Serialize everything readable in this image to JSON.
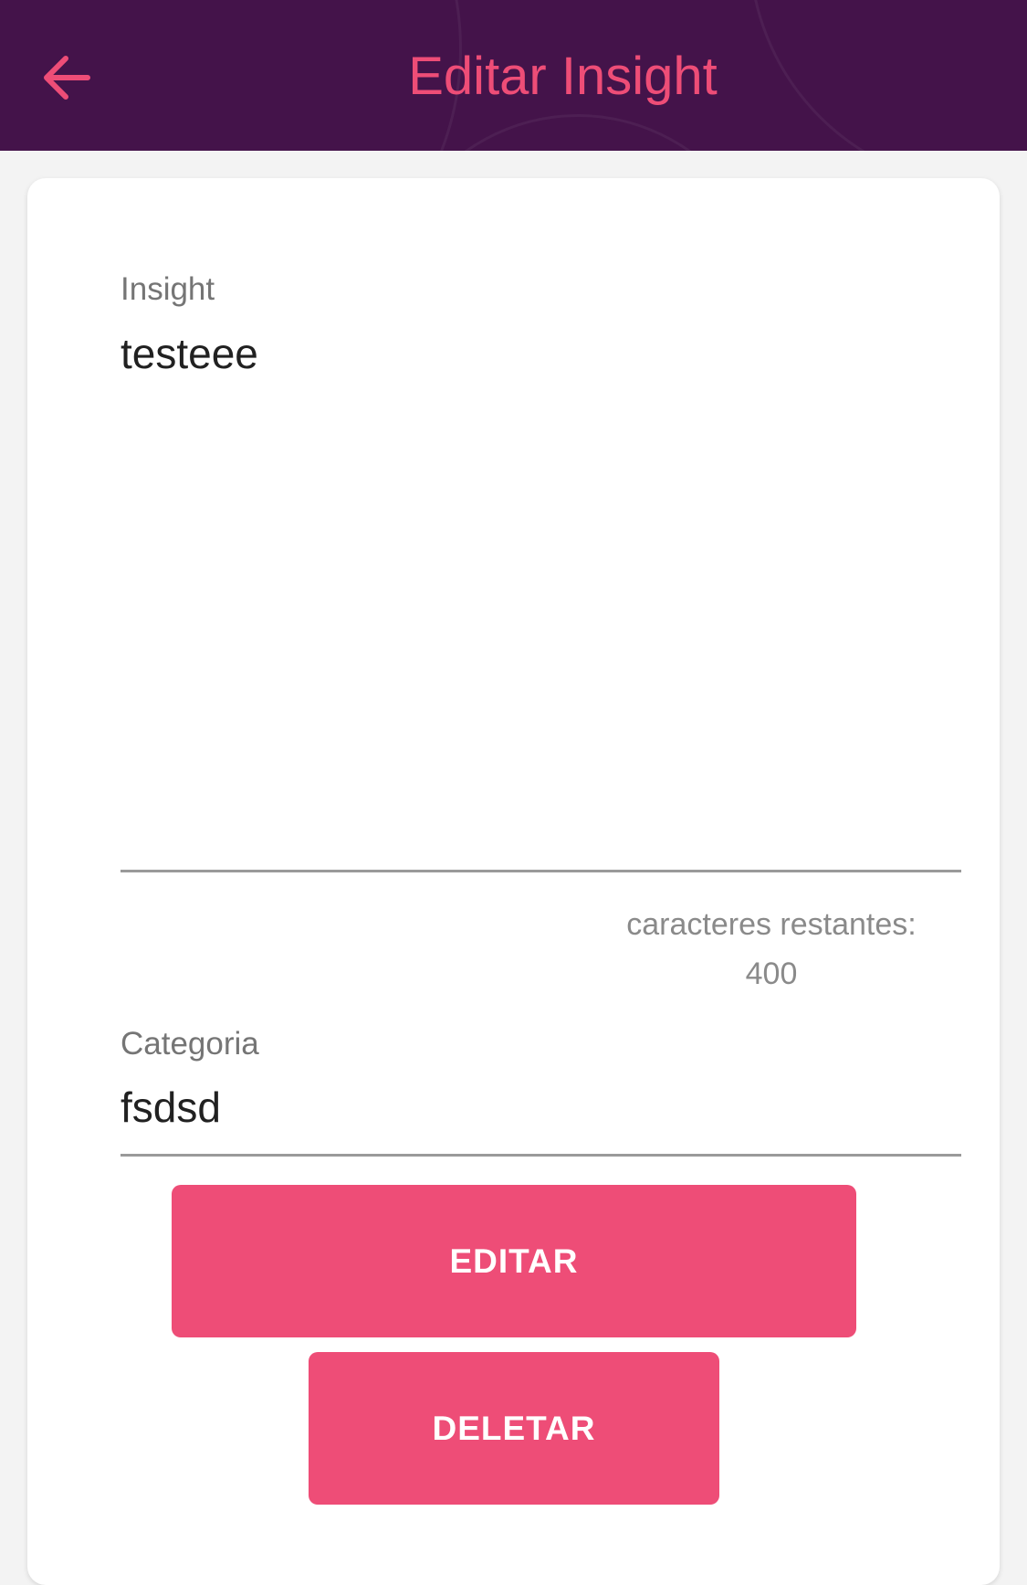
{
  "colors": {
    "header_bg": "#44134a",
    "accent": "#ee4d77",
    "card_bg": "#ffffff",
    "page_bg": "#f3f3f3"
  },
  "header": {
    "title": "Editar Insight",
    "back_icon": "arrow-left-icon"
  },
  "form": {
    "insight": {
      "label": "Insight",
      "value": "testeee"
    },
    "counter": {
      "label": "caracteres restantes:",
      "value": "400"
    },
    "categoria": {
      "label": "Categoria",
      "value": "fsdsd"
    },
    "edit_button": "EDITAR",
    "delete_button": "DELETAR"
  }
}
